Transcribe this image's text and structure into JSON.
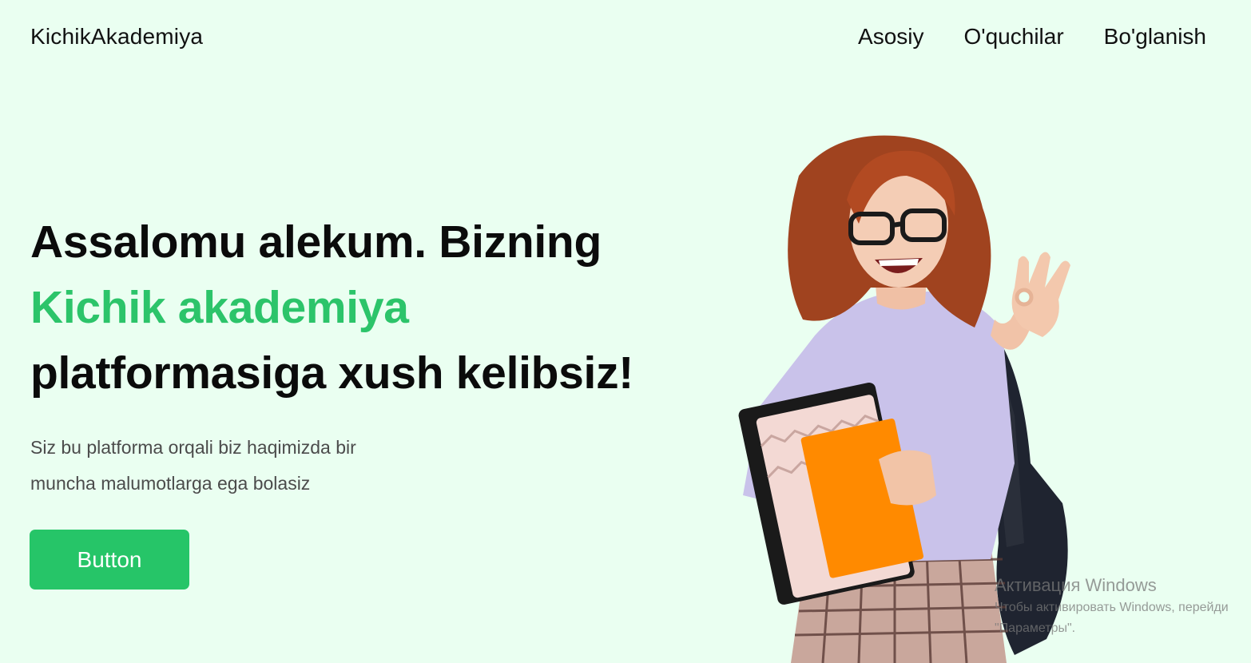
{
  "header": {
    "logo": "KichikAkademiya",
    "nav": [
      "Asosiy",
      "O'quchilar",
      "Bo'glanish"
    ]
  },
  "hero": {
    "title_line1": "Assalomu alekum. Bizning",
    "title_accent": "Kichik akademiya",
    "title_line3": "platformasiga xush kelibsiz!",
    "description_line1": "Siz bu platforma orqali biz haqimizda bir",
    "description_line2": "muncha malumotlarga ega bolasiz",
    "button_label": "Button"
  },
  "watermark": {
    "title": "Активация Windows",
    "line1": "Чтобы активировать Windows, перейди",
    "line2": "\"Параметры\"."
  },
  "colors": {
    "background": "#eafff1",
    "accent": "#2cc46a",
    "button": "#26c568"
  }
}
